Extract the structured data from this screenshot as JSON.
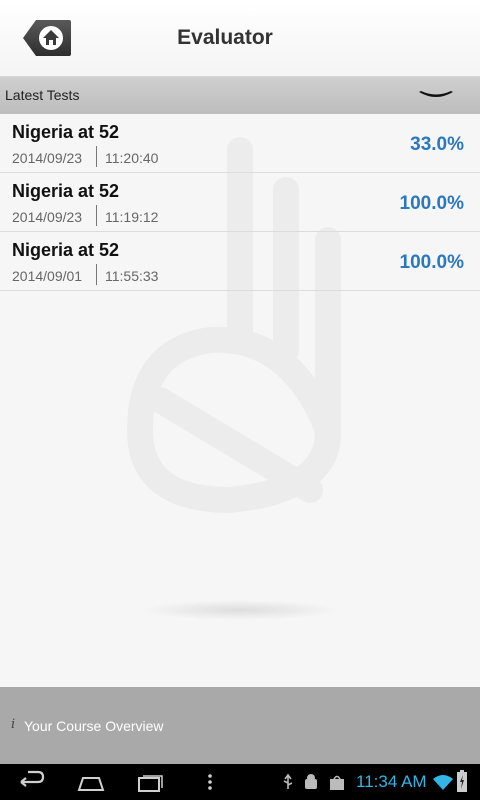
{
  "header": {
    "title": "Evaluator",
    "home_icon": "home-icon"
  },
  "section": {
    "title": "Latest Tests",
    "toggle_icon": "chevron-down-icon"
  },
  "tests": [
    {
      "title": "Nigeria at 52",
      "date": "2014/09/23",
      "time": "11:20:40",
      "score": "33.0%"
    },
    {
      "title": "Nigeria at 52",
      "date": "2014/09/23",
      "time": "11:19:12",
      "score": "100.0%"
    },
    {
      "title": "Nigeria at 52",
      "date": "2014/09/01",
      "time": "11:55:33",
      "score": "100.0%"
    }
  ],
  "footer": {
    "info_icon_char": "i",
    "label": "Your Course Overview"
  },
  "status_bar": {
    "time": "11:34 AM"
  },
  "colors": {
    "score": "#2a78c0",
    "clock": "#33b5e5"
  }
}
